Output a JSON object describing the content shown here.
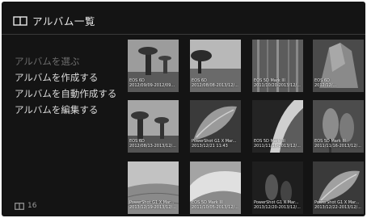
{
  "header": {
    "title": "アルバム一覧",
    "icon": "book-icon"
  },
  "menu": [
    {
      "label": "アルバムを選ぶ",
      "disabled": true
    },
    {
      "label": "アルバムを作成する",
      "disabled": false
    },
    {
      "label": "アルバムを自動作成する",
      "disabled": false
    },
    {
      "label": "アルバムを編集する",
      "disabled": false
    }
  ],
  "footer": {
    "count": "16",
    "icon": "book-icon"
  },
  "albums": [
    {
      "line1": "EOS 6D",
      "line2": "2012/09/09-2012/09..."
    },
    {
      "line1": "EOS 6D",
      "line2": "2012/08/08-2013/12/..."
    },
    {
      "line1": "EOS 5D Mark III",
      "line2": "2011/10/20-2013/12/..."
    },
    {
      "line1": "EOS 6D",
      "line2": "2012/12/..."
    },
    {
      "line1": "EOS 6D",
      "line2": "2012/08/13-2013/12/..."
    },
    {
      "line1": "PowerShot G1 X Mar...",
      "line2": "2013/12/21 11:43"
    },
    {
      "line1": "EOS 5D Mark III",
      "line2": "2011/11/16-2013/12/..."
    },
    {
      "line1": "EOS 5D Mark III",
      "line2": "2011/11/16-2013/12/..."
    },
    {
      "line1": "PowerShot G1 X Mar...",
      "line2": "2013/12/19-2013/12/..."
    },
    {
      "line1": "EOS 5D Mark III",
      "line2": "2011/10/05-2013/12/..."
    },
    {
      "line1": "PowerShot G1 X Mar...",
      "line2": "2013/12/20-2013/12/..."
    },
    {
      "line1": "PowerShot G1 X Mar...",
      "line2": "2013/12/22-2013/12/..."
    }
  ],
  "colors": {
    "background": "#141414",
    "text": "#e8e8e8",
    "disabled": "#6c6c6c"
  }
}
